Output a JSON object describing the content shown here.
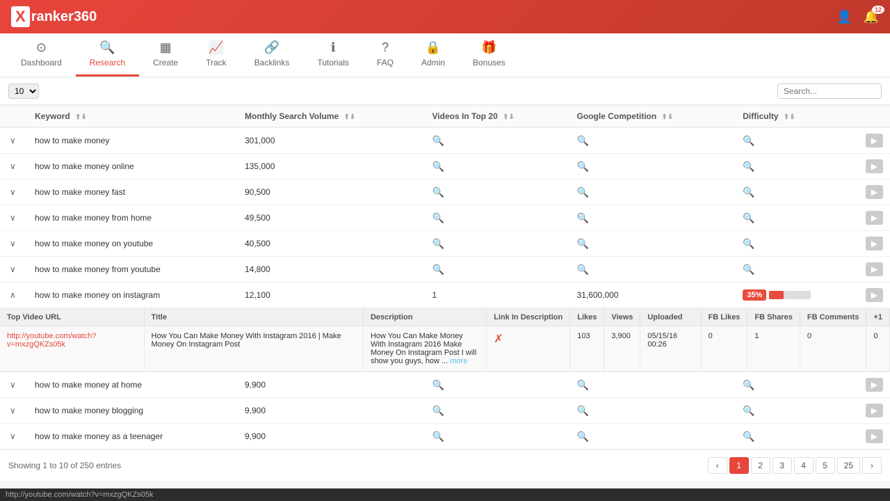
{
  "header": {
    "logo_text": "ranker360",
    "logo_x": "X",
    "notifications_count": "12"
  },
  "nav": {
    "items": [
      {
        "id": "dashboard",
        "label": "Dashboard",
        "icon": "⊙",
        "active": false
      },
      {
        "id": "research",
        "label": "Research",
        "icon": "🔍",
        "active": true
      },
      {
        "id": "create",
        "label": "Create",
        "icon": "▦",
        "active": false
      },
      {
        "id": "track",
        "label": "Track",
        "icon": "📈",
        "active": false
      },
      {
        "id": "backlinks",
        "label": "Backlinks",
        "icon": "🔗",
        "active": false
      },
      {
        "id": "tutorials",
        "label": "Tutorials",
        "icon": "ℹ",
        "active": false
      },
      {
        "id": "faq",
        "label": "FAQ",
        "icon": "?",
        "active": false
      },
      {
        "id": "admin",
        "label": "Admin",
        "icon": "🔒",
        "active": false
      },
      {
        "id": "bonuses",
        "label": "Bonuses",
        "icon": "🎁",
        "active": false
      }
    ]
  },
  "toolbar": {
    "per_page": "10",
    "search_placeholder": "Search..."
  },
  "table": {
    "columns": [
      {
        "id": "expand",
        "label": ""
      },
      {
        "id": "keyword",
        "label": "Keyword"
      },
      {
        "id": "monthly_search_volume",
        "label": "Monthly Search Volume"
      },
      {
        "id": "videos_in_top20",
        "label": "Videos In Top 20"
      },
      {
        "id": "google_competition",
        "label": "Google Competition"
      },
      {
        "id": "difficulty",
        "label": "Difficulty"
      },
      {
        "id": "action",
        "label": ""
      }
    ],
    "rows": [
      {
        "id": 1,
        "keyword": "how to make money",
        "monthly_search_volume": "301,000",
        "expanded": false
      },
      {
        "id": 2,
        "keyword": "how to make money online",
        "monthly_search_volume": "135,000",
        "expanded": false
      },
      {
        "id": 3,
        "keyword": "how to make money fast",
        "monthly_search_volume": "90,500",
        "expanded": false
      },
      {
        "id": 4,
        "keyword": "how to make money from home",
        "monthly_search_volume": "49,500",
        "expanded": false
      },
      {
        "id": 5,
        "keyword": "how to make money on youtube",
        "monthly_search_volume": "40,500",
        "expanded": false
      },
      {
        "id": 6,
        "keyword": "how to make money from youtube",
        "monthly_search_volume": "14,800",
        "expanded": false
      },
      {
        "id": 7,
        "keyword": "how to make money on instagram",
        "monthly_search_volume": "12,100",
        "expanded": true,
        "videos_in_top20": "1",
        "google_competition": "31,600,000",
        "difficulty_value": "35",
        "expanded_data": {
          "columns": [
            "Top Video URL",
            "Title",
            "Description",
            "Link In Description",
            "Likes",
            "Views",
            "Uploaded",
            "FB Likes",
            "FB Shares",
            "FB Comments",
            "+1"
          ],
          "row": {
            "url": "http://youtube.com/watch?v=mxzgQKZs05k",
            "title": "How You Can Make Money With Instagram 2016 | Make Money On Instagram Post",
            "description": "How You Can Make Money With Instagram 2016 Make Money On Instagram Post I will show you guys, how ...",
            "description_more": "more",
            "link_in_description": "✗",
            "likes": "103",
            "views": "3,900",
            "uploaded": "05/15/16 00:26",
            "fb_likes": "0",
            "fb_shares": "1",
            "fb_comments": "0",
            "plus1": "0"
          }
        }
      },
      {
        "id": 8,
        "keyword": "how to make money at home",
        "monthly_search_volume": "9,900",
        "expanded": false
      },
      {
        "id": 9,
        "keyword": "how to make money blogging",
        "monthly_search_volume": "9,900",
        "expanded": false
      },
      {
        "id": 10,
        "keyword": "how to make money as a teenager",
        "monthly_search_volume": "9,900",
        "expanded": false
      }
    ]
  },
  "pagination": {
    "info": "Showing 1 to 10 of 250 entries",
    "pages": [
      "1",
      "2",
      "3",
      "4",
      "5",
      "25"
    ],
    "active_page": "1"
  },
  "status_bar": {
    "url": "http://youtube.com/watch?v=mxzgQKZs05k"
  }
}
